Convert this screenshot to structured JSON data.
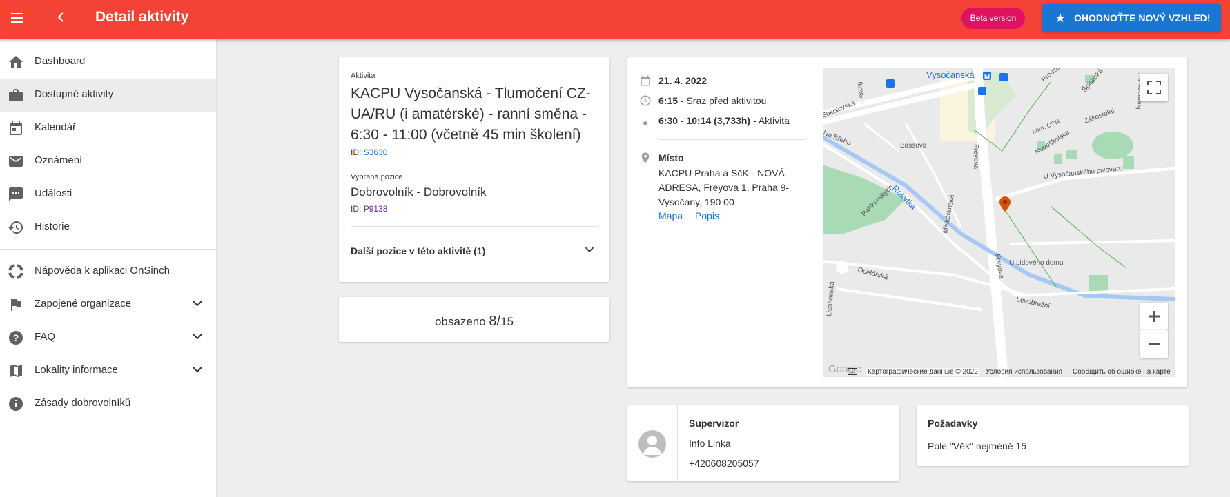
{
  "header": {
    "title": "Detail aktivity",
    "beta_label": "Beta version",
    "rate_label": "OHODNOŤTE NOVÝ VZHLED!",
    "colors": {
      "bar": "#f44336",
      "beta": "#e0115f",
      "rate": "#1976d2"
    }
  },
  "sidebar": {
    "items": [
      {
        "label": "Dashboard",
        "icon": "home-icon"
      },
      {
        "label": "Dostupné aktivity",
        "icon": "briefcase-icon"
      },
      {
        "label": "Kalendář",
        "icon": "calendar-icon"
      },
      {
        "label": "Oznámení",
        "icon": "mail-icon"
      },
      {
        "label": "Události",
        "icon": "chat-icon"
      },
      {
        "label": "Historie",
        "icon": "history-icon"
      },
      {
        "label": "Nápověda k aplikaci OnSinch",
        "icon": "lifebuoy-icon"
      },
      {
        "label": "Zapojené organizace",
        "icon": "flag-icon"
      },
      {
        "label": "FAQ",
        "icon": "help-icon"
      },
      {
        "label": "Lokality informace",
        "icon": "map-icon"
      },
      {
        "label": "Zásady dobrovolníků",
        "icon": "info-icon"
      }
    ]
  },
  "activity": {
    "label": "Aktivita",
    "title": "KACPU Vysočanská - Tlumočení CZ-UA/RU (i amatérské) - ranní směna - 6:30 - 11:00 (včetně 45 min školení)",
    "id_prefix": "ID:",
    "id": "S3630",
    "position_label": "Vybraná pozice",
    "position": "Dobrovolník - Dobrovolník",
    "position_id": "P9138",
    "more_positions": "Další pozice v této aktivitě (1)"
  },
  "occupancy": {
    "prefix": "obsazeno",
    "filled": "8",
    "sep": "/",
    "total": "15"
  },
  "details": {
    "date": "21. 4. 2022",
    "meet_time": "6:15",
    "meet_text": "- Sraz před aktivitou",
    "activity_time": "6:30 - 10:14 (3,733h)",
    "activity_text": "- Aktivita",
    "place_label": "Místo",
    "place_address": "KACPU Praha a SčK - NOVÁ ADRESA, Freyova 1, Praha 9-Vysočany, 190 00",
    "map_link": "Mapa",
    "desc_link": "Popis"
  },
  "map": {
    "streets": [
      "Vysočanská",
      "Sokolovská",
      "Bassova",
      "Freyova",
      "Novoškolská",
      "Zákostelní",
      "U Vysočanského pivovaru",
      "nám. OSN",
      "Prouzova",
      "Špitálská",
      "Nemocniční",
      "Na Břehu",
      "Rokytka",
      "Paříkovských",
      "Mělkárenská",
      "U Lidového domu",
      "Ocelářská",
      "Lisabonská",
      "Levobřežní",
      "Ikova"
    ],
    "attribution": "Картографические данные © 2022",
    "terms": "Условия использования",
    "report": "Сообщить об ошибке на карте",
    "logo": "Google"
  },
  "supervisor": {
    "label": "Supervizor",
    "name": "Info Linka",
    "phone": "+420608205057"
  },
  "requirements": {
    "label": "Požadavky",
    "text": "Pole \"Věk\" nejméně 15"
  }
}
